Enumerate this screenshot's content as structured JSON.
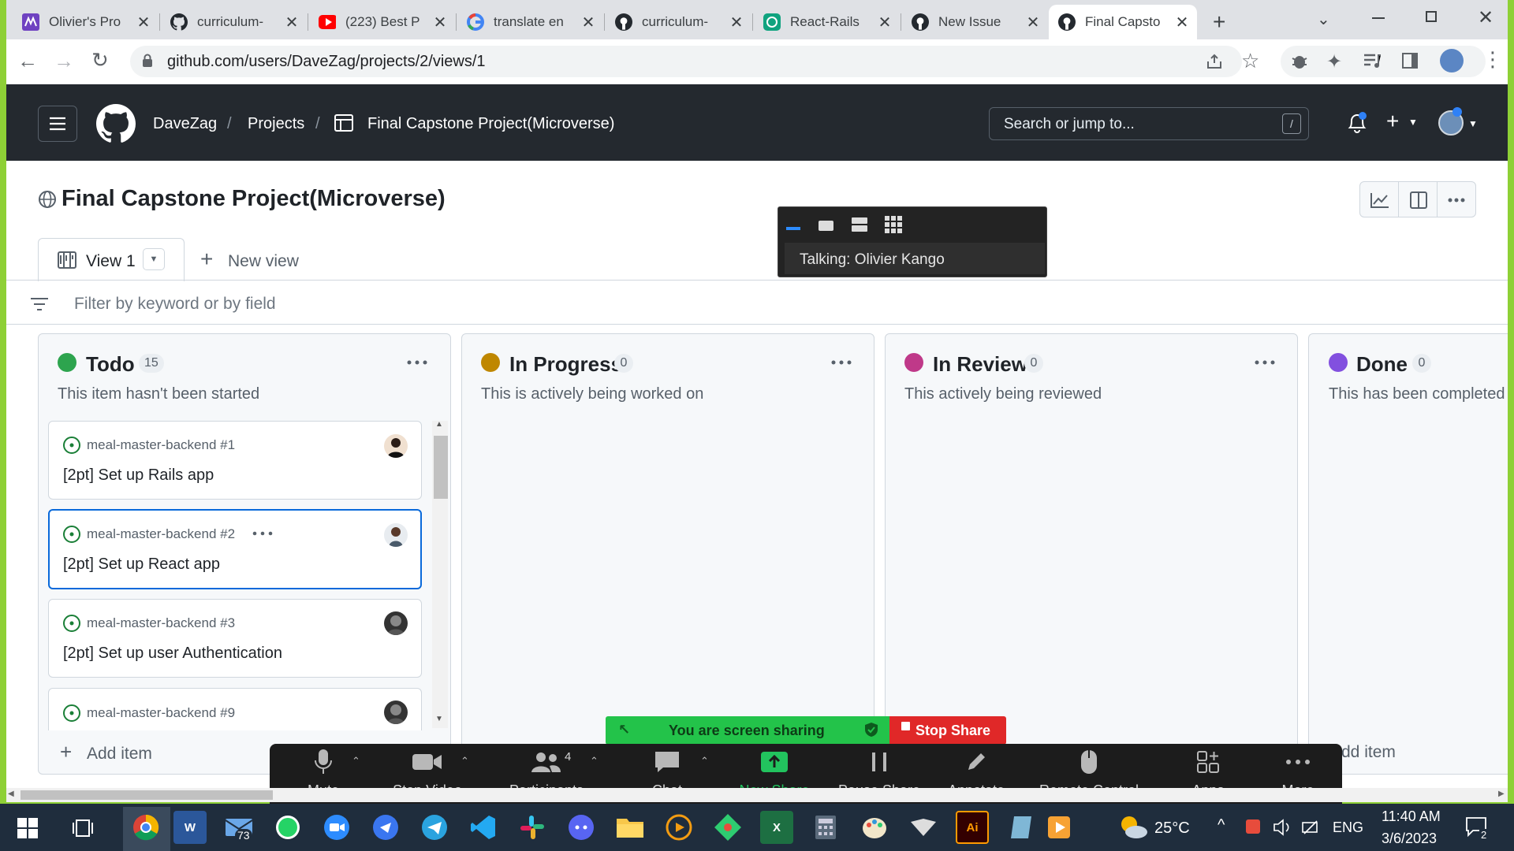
{
  "browser": {
    "tabs": [
      {
        "title": "Olivier's Pro",
        "icon": "olivier-favicon",
        "color": "#6f42c1"
      },
      {
        "title": "curriculum-",
        "icon": "github-favicon",
        "color": "#000000"
      },
      {
        "title": "(223) Best P",
        "icon": "youtube-favicon",
        "color": "#ff0000"
      },
      {
        "title": "translate en",
        "icon": "google-favicon",
        "color": "#4285f4"
      },
      {
        "title": "curriculum-",
        "icon": "github-favicon",
        "color": "#000000"
      },
      {
        "title": "React-Rails",
        "icon": "chatgpt-favicon",
        "color": "#10a37f"
      },
      {
        "title": "New Issue",
        "icon": "github-favicon",
        "color": "#000000"
      },
      {
        "title": "Final Capsto",
        "icon": "github-favicon",
        "color": "#000000",
        "active": true
      }
    ],
    "url": "github.com/users/DaveZag/projects/2/views/1"
  },
  "github": {
    "breadcrumb": [
      "DaveZag",
      "Projects",
      "Final Capstone Project(Microverse)"
    ],
    "search_placeholder": "Search or jump to...",
    "search_shortcut": "/"
  },
  "project": {
    "title": "Final Capstone Project(Microverse)",
    "view_tab": "View 1",
    "new_view": "New view",
    "filter_placeholder": "Filter by keyword or by field",
    "columns": [
      {
        "name": "Todo",
        "count": "15",
        "description": "This item hasn't been started",
        "color": "#2da44e"
      },
      {
        "name": "In Progress",
        "count": "0",
        "description": "This is actively being worked on",
        "color": "#bf8700"
      },
      {
        "name": "In Review",
        "count": "0",
        "description": "This actively being reviewed",
        "color": "#bf3989"
      },
      {
        "name": "Done",
        "count": "0",
        "description": "This has been completed",
        "color": "#8250df"
      }
    ],
    "cards": [
      {
        "repo": "meal-master-backend #1",
        "title": "[2pt] Set up Rails app"
      },
      {
        "repo": "meal-master-backend #2",
        "title": "[2pt] Set up React app"
      },
      {
        "repo": "meal-master-backend #3",
        "title": "[2pt] Set up user Authentication"
      },
      {
        "repo": "meal-master-backend #9",
        "title": ""
      }
    ],
    "add_item": "Add item"
  },
  "zoom": {
    "talking": "Talking: Olivier Kango",
    "sharing_status": "You are screen sharing",
    "stop_share": "Stop Share",
    "participants_count": "4",
    "toolbar": [
      "Mute",
      "Stop Video",
      "Participants",
      "Chat",
      "New Share",
      "Pause Share",
      "Annotate",
      "Remote Control",
      "Apps",
      "More"
    ]
  },
  "taskbar": {
    "mail_badge": "73",
    "weather": "25°C",
    "language": "ENG",
    "time": "11:40 AM",
    "date": "3/6/2023",
    "notification_count": "2"
  }
}
